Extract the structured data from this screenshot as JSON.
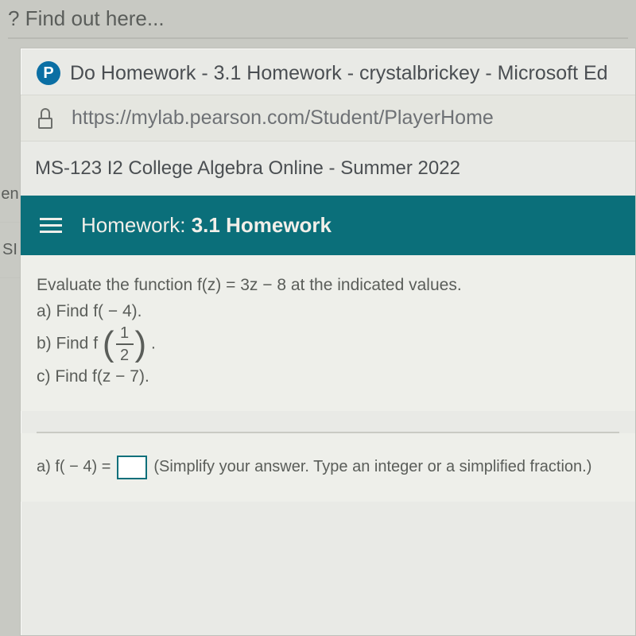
{
  "banner": {
    "text": "? Find out here..."
  },
  "rail": {
    "stub1": "en",
    "stub2": "SI"
  },
  "window": {
    "icon_letter": "P",
    "title": "Do Homework - 3.1 Homework - crystalbrickey - Microsoft Ed",
    "url": "https://mylab.pearson.com/Student/PlayerHome"
  },
  "course": {
    "name": "MS-123 I2 College Algebra Online - Summer 2022"
  },
  "homework": {
    "label_prefix": "Homework:",
    "label_name": "3.1 Homework"
  },
  "problem": {
    "prompt": "Evaluate the function f(z) = 3z − 8 at the indicated values.",
    "a": "a) Find f( − 4).",
    "b_prefix": "b) Find f",
    "b_num": "1",
    "b_den": "2",
    "b_suffix": ".",
    "c": "c) Find f(z − 7)."
  },
  "answer": {
    "a_prefix": "a) f( − 4) =",
    "a_hint": "(Simplify your answer. Type an integer or a simplified fraction.)"
  }
}
